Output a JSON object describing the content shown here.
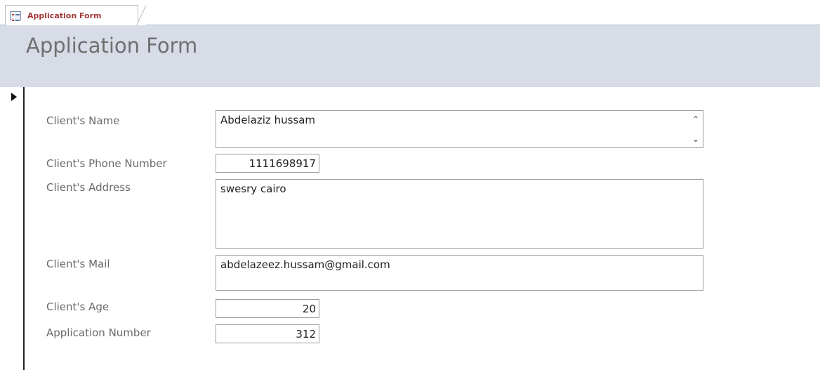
{
  "tab": {
    "label": "Application Form"
  },
  "header": {
    "title": "Application Form"
  },
  "fields": {
    "client_name": {
      "label": "Client's Name",
      "value": "Abdelaziz hussam"
    },
    "client_phone": {
      "label": "Client's Phone Number",
      "value": "1111698917"
    },
    "client_address": {
      "label": "Client's Address",
      "value": "swesry cairo"
    },
    "client_mail": {
      "label": "Client's Mail",
      "value": "abdelazeez.hussam@gmail.com"
    },
    "client_age": {
      "label": "Client's Age",
      "value": "20"
    },
    "application_number": {
      "label": "Application Number",
      "value": "312"
    }
  },
  "scroll": {
    "up": "⌃",
    "down": "⌄"
  },
  "colors": {
    "header_bg": "#d7dce7",
    "tab_text": "#a4373a",
    "label_text": "#6a6a6a"
  }
}
